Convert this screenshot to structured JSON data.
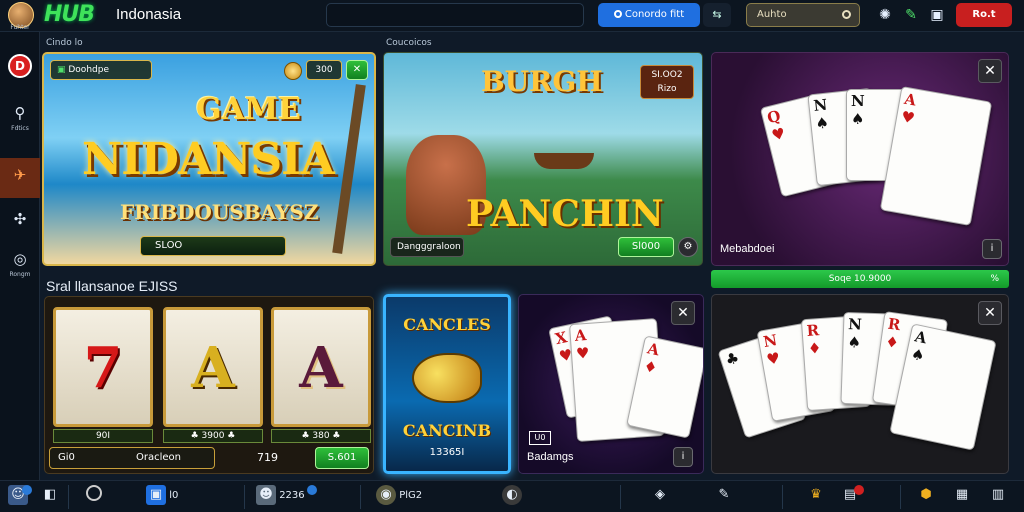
{
  "header": {
    "brand": "HUB",
    "site": "Indonasia",
    "notify_label": "Conordo fitt",
    "search_label": "Auhto",
    "signin_label": "Ro.t"
  },
  "sidebar": {
    "items": [
      {
        "label": "Fuhter",
        "icon": "avatar-icon"
      },
      {
        "label": "",
        "icon": "record-icon"
      },
      {
        "label": "Fdtics",
        "icon": "search-icon"
      },
      {
        "label": "",
        "icon": "fish-icon"
      },
      {
        "label": "",
        "icon": "puzzle-icon"
      },
      {
        "label": "Rongm",
        "icon": "settings-icon"
      }
    ]
  },
  "sections": {
    "top_left_label": "Cindo lo",
    "top_mid_label": "Coucoicos",
    "slots_title": "Sral llansanoe EJISS"
  },
  "cards": {
    "game": {
      "tag": "Doohdpe",
      "coins": "300",
      "title_1": "GAME",
      "title_2": "NIDANSIA",
      "title_3": "FRIBDOUSBAYSZ",
      "play": "SLOO"
    },
    "panchin": {
      "title_top": "BURGH",
      "badge": "SI.OO2 Rizo",
      "title": "PANCHIN",
      "label": "Dangggraloon",
      "play": "Sl000"
    },
    "cards_top": {
      "label": "Mebabdoei",
      "green_bar": "Soqe 10.9000",
      "green_bar_end": "%"
    },
    "slots": {
      "reel_1": "7",
      "reel_2": "A",
      "reel_3": "A",
      "amt_1": "90I",
      "amt_2": "♣ 3900 ♣",
      "amt_3": "♣ 380 ♣",
      "coin_label": "Gi0",
      "name": "Oracleon",
      "value": "719",
      "play": "S.601"
    },
    "fish": {
      "title_top": "CANCLES",
      "title_bottom": "CANCINB",
      "value": "13365I"
    },
    "badam": {
      "badge": "U0",
      "label": "Badamgs"
    }
  },
  "bottombar": {
    "items": [
      {
        "label": "",
        "icon": "avatar-icon"
      },
      {
        "label": "",
        "icon": "back-icon"
      },
      {
        "label": "",
        "icon": "profile-icon"
      },
      {
        "label": "l0",
        "icon": "app-icon"
      },
      {
        "label": "2236",
        "icon": "user-icon"
      },
      {
        "label": "PlG2",
        "icon": "coin-icon"
      },
      {
        "label": "",
        "icon": "chat-icon"
      },
      {
        "label": "",
        "icon": "chip-icon"
      },
      {
        "label": "",
        "icon": "edit-icon"
      },
      {
        "label": "",
        "icon": "trophy-icon"
      },
      {
        "label": "",
        "icon": "gift-icon"
      },
      {
        "label": "",
        "icon": "shield-icon"
      },
      {
        "label": "",
        "icon": "grid-icon"
      },
      {
        "label": "",
        "icon": "doc-icon"
      }
    ]
  },
  "colors": {
    "accent_green": "#2cc84a",
    "accent_blue": "#1f6fe0",
    "accent_red": "#c81f1f",
    "gold": "#ffcc22"
  }
}
